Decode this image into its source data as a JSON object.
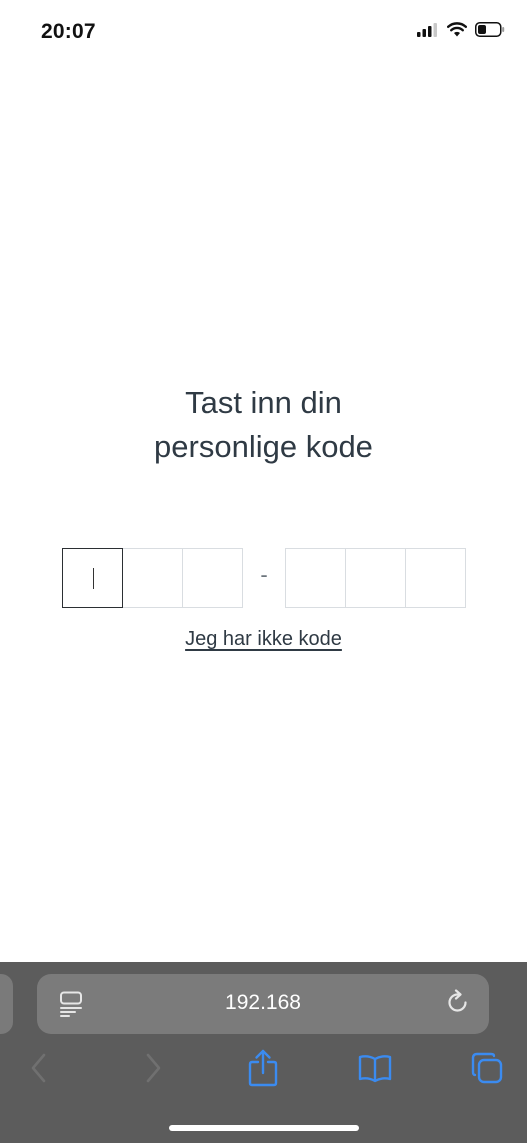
{
  "status_bar": {
    "time": "20:07",
    "icons": [
      "cellular-signal-icon",
      "wifi-icon",
      "battery-icon"
    ]
  },
  "main": {
    "title_line1": "Tast inn din",
    "title_line2": "personlige kode",
    "separator": "-",
    "no_code_link": "Jeg har ikke kode"
  },
  "browser": {
    "address": "192.168",
    "toolbar_icons": [
      "back-icon",
      "forward-icon",
      "share-icon",
      "bookmarks-icon",
      "tabs-icon"
    ],
    "colors": {
      "bar_background": "#5c5c5c",
      "field_background": "#7b7b7b",
      "active_icon": "#3b8bf0",
      "inactive_icon": "#707070"
    }
  }
}
